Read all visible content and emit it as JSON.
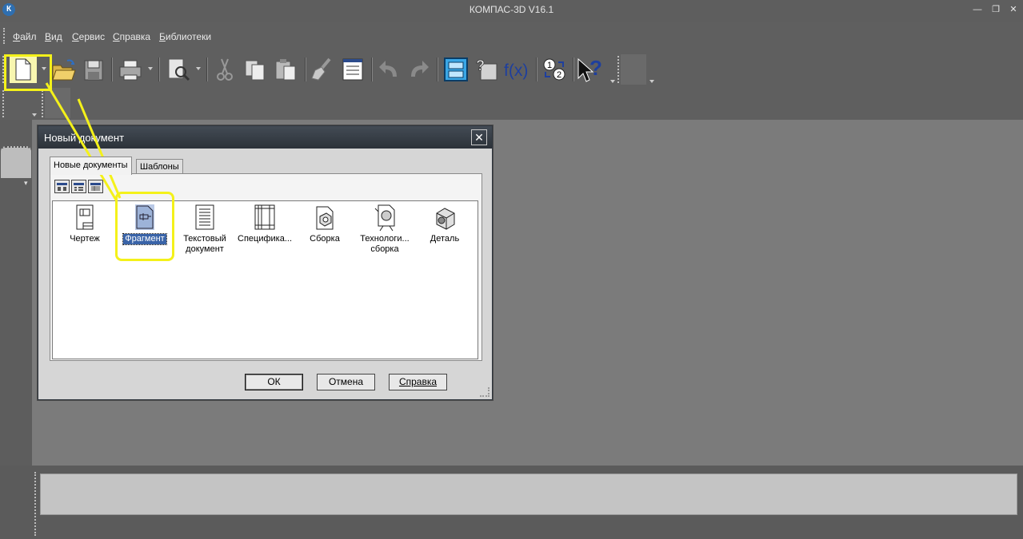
{
  "window": {
    "title": "КОМПАС-3D V16.1",
    "logo": "К"
  },
  "menu": {
    "items": [
      "Файл",
      "Вид",
      "Сервис",
      "Справка",
      "Библиотеки"
    ]
  },
  "toolbar": {
    "icons": [
      "new-document-icon",
      "open-icon",
      "save-icon",
      "print-icon",
      "preview-icon",
      "cut-icon",
      "copy-icon",
      "paste-icon",
      "brush-icon",
      "properties-icon",
      "undo-icon",
      "redo-icon",
      "manager-icon",
      "variables-icon",
      "function-icon",
      "parameters-icon",
      "help-cursor-icon"
    ],
    "function_glyph": "f(x)",
    "help_glyph": "?"
  },
  "dialog": {
    "title": "Новый документ",
    "close_glyph": "✕",
    "tabs": [
      {
        "label": "Новые документы",
        "active": true
      },
      {
        "label": "Шаблоны",
        "active": false
      }
    ],
    "items": [
      {
        "label": "Чертеж",
        "icon": "drawing-icon"
      },
      {
        "label": "Фрагмент",
        "icon": "fragment-icon",
        "selected": true
      },
      {
        "label": "Текстовый документ",
        "icon": "text-document-icon"
      },
      {
        "label": "Специфика...",
        "icon": "specification-icon"
      },
      {
        "label": "Сборка",
        "icon": "assembly-icon"
      },
      {
        "label": "Технологи... сборка",
        "icon": "tech-assembly-icon"
      },
      {
        "label": "Деталь",
        "icon": "part-icon"
      }
    ],
    "buttons": {
      "ok": "ОК",
      "cancel": "Отмена",
      "help": "Справка"
    }
  },
  "colors": {
    "highlight": "#f4f11a",
    "selection": "#3a64a8",
    "chrome": "#5f5f5f"
  }
}
